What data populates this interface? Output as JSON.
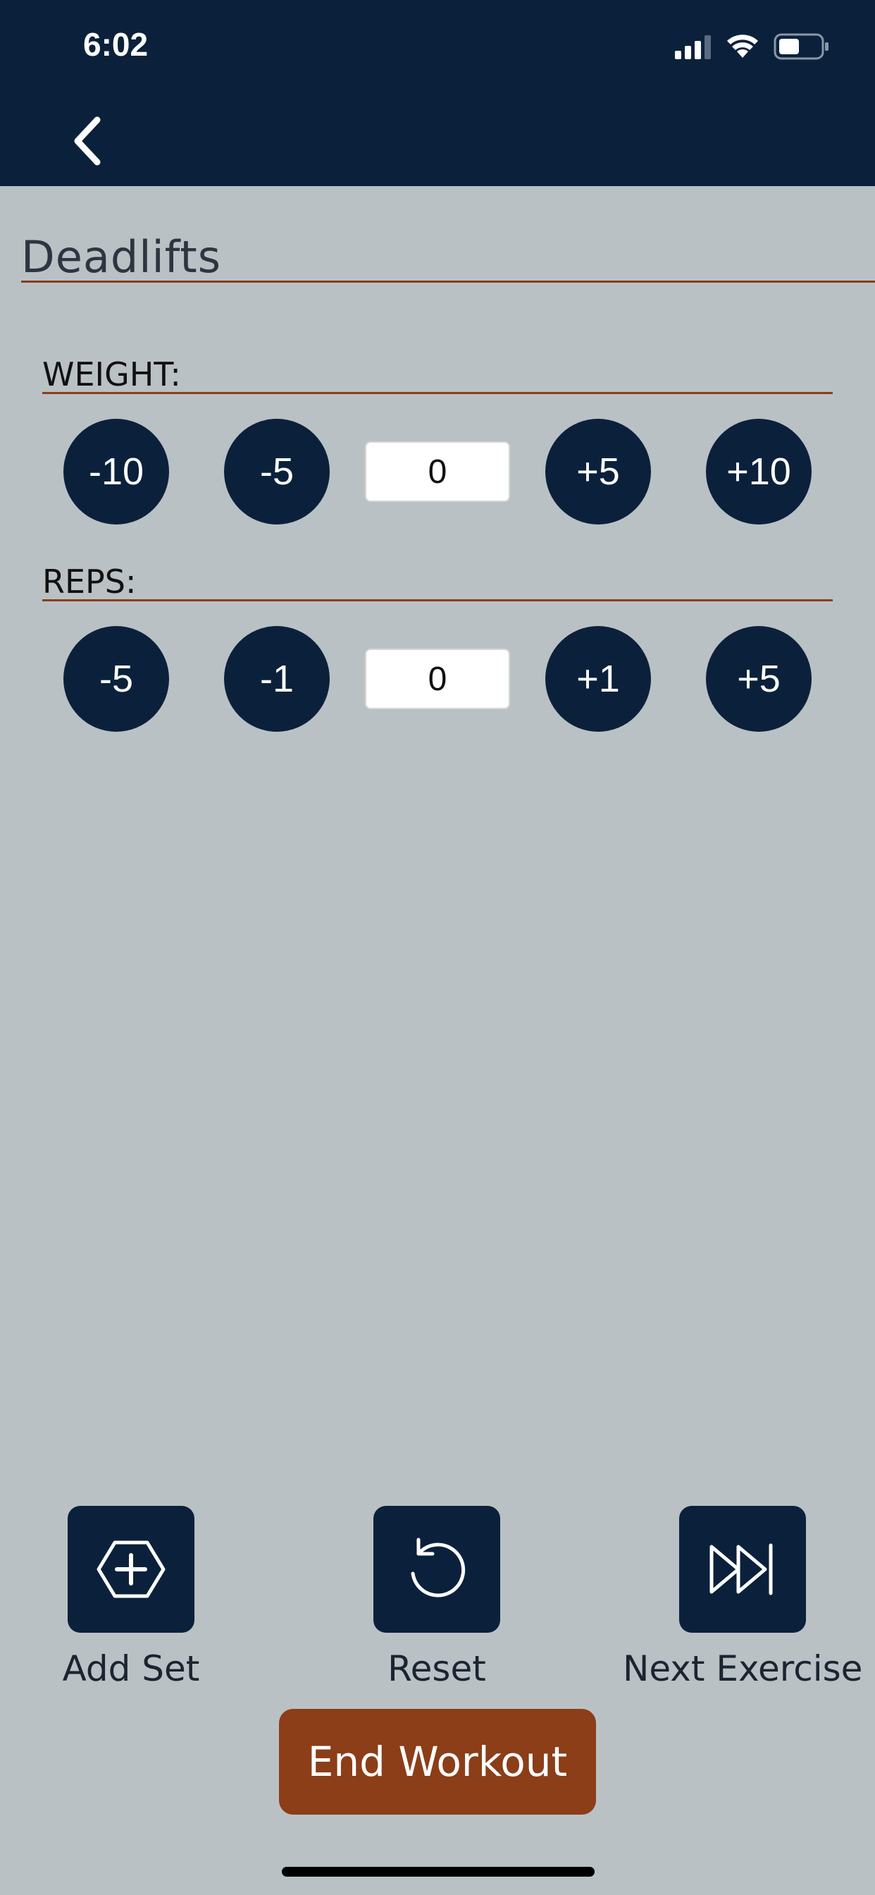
{
  "status_bar": {
    "time": "6:02"
  },
  "header": {
    "back_icon": "chevron-left-icon"
  },
  "exercise": {
    "title": "Deadlifts"
  },
  "weight": {
    "label": "WEIGHT:",
    "buttons": [
      "-10",
      "-5",
      "+5",
      "+10"
    ],
    "value": "0"
  },
  "reps": {
    "label": "REPS:",
    "buttons": [
      "-5",
      "-1",
      "+1",
      "+5"
    ],
    "value": "0"
  },
  "actions": {
    "add_set": {
      "label": "Add Set",
      "icon": "hexagon-plus-icon"
    },
    "reset": {
      "label": "Reset",
      "icon": "reset-icon"
    },
    "next_exercise": {
      "label": "Next Exercise",
      "icon": "fast-forward-icon"
    }
  },
  "end_workout_label": "End Workout",
  "colors": {
    "header": "#0b213b",
    "background": "#bac1c5",
    "accent": "#8b3e18"
  }
}
